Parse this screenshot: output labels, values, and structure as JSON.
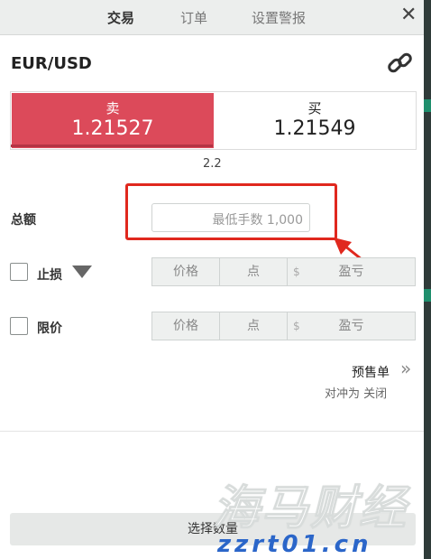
{
  "tabs": [
    {
      "label": "交易",
      "active": true
    },
    {
      "label": "订单",
      "active": false
    },
    {
      "label": "设置警报",
      "active": false
    }
  ],
  "close_icon": "close-icon",
  "pair": "EUR/USD",
  "link_icon": "link-icon",
  "quote": {
    "sell_label": "卖",
    "sell_price": "1.21527",
    "buy_label": "买",
    "buy_price": "1.21549",
    "spread": "2.2",
    "sell_color": "#dc4a5a"
  },
  "amount": {
    "label": "总额",
    "placeholder": "最低手数 1,000"
  },
  "stop_loss": {
    "label": "止损",
    "checked": false,
    "price": "价格",
    "points": "点",
    "currency": "$",
    "pnl": "盈亏"
  },
  "limit": {
    "label": "限价",
    "checked": false,
    "price": "价格",
    "points": "点",
    "currency": "$",
    "pnl": "盈亏"
  },
  "pending_order": {
    "label": "预售单",
    "hedge_text": "对冲为 关闭"
  },
  "footer": {
    "button_label": "选择数量"
  },
  "watermark": {
    "text": "海马财经",
    "url": "zzrt01.cn"
  },
  "colors": {
    "annotation": "#e0281e",
    "accent_green": "#1f8f6d"
  }
}
